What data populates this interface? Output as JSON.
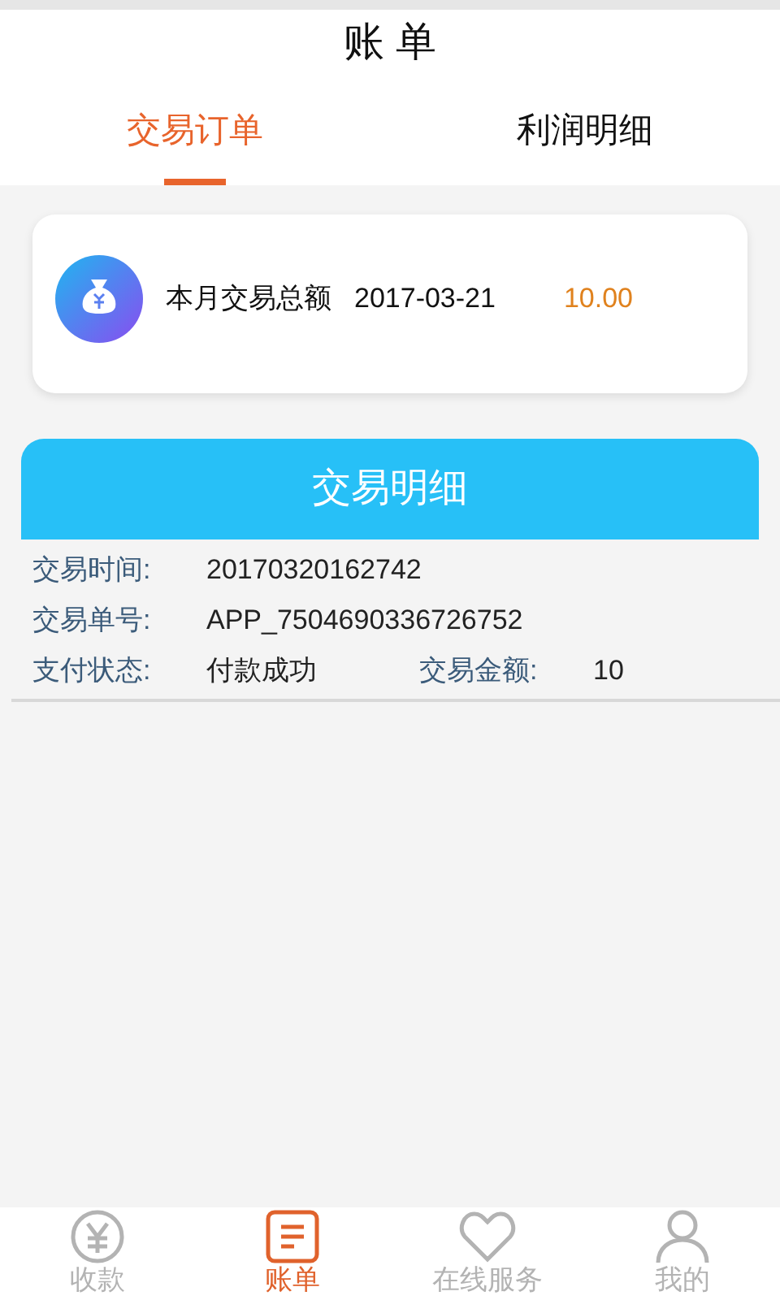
{
  "header": {
    "title": "账 单"
  },
  "tabs": [
    {
      "label": "交易订单",
      "selected": true
    },
    {
      "label": "利润明细",
      "selected": false
    }
  ],
  "summary": {
    "label": "本月交易总额",
    "date": "2017-03-21",
    "amount": "10.00"
  },
  "detail": {
    "title": "交易明细",
    "time_label": "交易时间:",
    "time": "20170320162742",
    "order_label": "交易单号:",
    "order": "APP_7504690336726752",
    "status_label": "支付状态:",
    "status": "付款成功",
    "amount_label": "交易金额:",
    "amount": "10"
  },
  "nav": [
    {
      "label": "收款",
      "selected": false
    },
    {
      "label": "账单",
      "selected": true
    },
    {
      "label": "在线服务",
      "selected": false
    },
    {
      "label": "我的",
      "selected": false
    }
  ]
}
